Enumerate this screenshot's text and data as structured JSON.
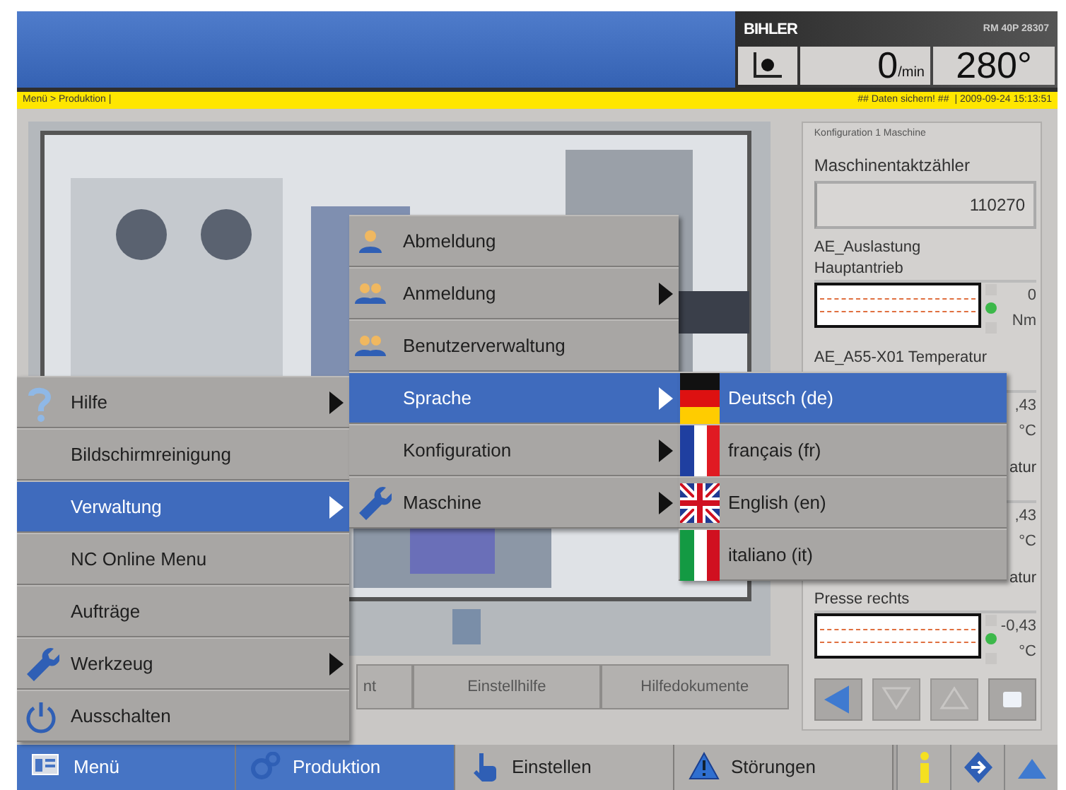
{
  "header": {
    "logo": "BIHLER",
    "machine": "RM 40P 28307",
    "speed": "0",
    "speed_unit": "/min",
    "angle": "280°"
  },
  "status_bar": {
    "breadcrumb": "Menü > Produktion |",
    "notice": "## Daten sichern! ##",
    "timestamp": "| 2009-09-24 15:13:51"
  },
  "work": {
    "buttons": [
      {
        "label": "nt",
        "kind": "cut"
      },
      {
        "label": "Einstellhilfe",
        "kind": "whole"
      },
      {
        "label": "Hilfedokumente",
        "kind": "whole"
      }
    ]
  },
  "side_panel": {
    "title": "Konfiguration 1 Maschine",
    "counter_label": "Maschinentaktzähler",
    "counter_value": "110270",
    "sensors": [
      {
        "lines": [
          {
            "text": "AE_Auslastung",
            "kind": "whole"
          },
          {
            "text": "Hauptantrieb",
            "kind": "whole"
          }
        ],
        "kind": "gauge",
        "value": "0",
        "unit": "Nm"
      },
      {
        "lines": [
          {
            "text": "AE_A55-X01 Temperatur",
            "kind": "whole"
          }
        ],
        "kind": "covered",
        "value": ",43",
        "unit": "°C"
      },
      {
        "lines": [
          {
            "text": "atur",
            "kind": "cut"
          }
        ],
        "kind": "covered",
        "value": ",43",
        "unit": "°C"
      },
      {
        "lines": [
          {
            "text": "atur",
            "kind": "cut"
          },
          {
            "text": "Presse rechts",
            "kind": "whole"
          }
        ],
        "kind": "gauge",
        "value": "-0,43",
        "unit": "°C"
      }
    ],
    "nav_buttons": [
      {
        "disabled": false
      },
      {
        "disabled": true
      },
      {
        "disabled": true
      },
      {
        "disabled": false
      }
    ]
  },
  "menus": [
    {
      "items": [
        {
          "label": "Hilfe",
          "submenu": true,
          "selected": false
        },
        {
          "label": "Bildschirmreinigung",
          "submenu": false,
          "selected": false
        },
        {
          "label": "Verwaltung",
          "submenu": true,
          "selected": true
        },
        {
          "label": "NC Online Menu",
          "submenu": false,
          "selected": false
        },
        {
          "label": "Aufträge",
          "submenu": false,
          "selected": false
        },
        {
          "label": "Werkzeug",
          "submenu": true,
          "selected": false
        },
        {
          "label": "Ausschalten",
          "submenu": false,
          "selected": false
        }
      ]
    },
    {
      "items": [
        {
          "label": "Abmeldung",
          "submenu": false,
          "selected": false
        },
        {
          "label": "Anmeldung",
          "submenu": true,
          "selected": false
        },
        {
          "label": "Benutzerverwaltung",
          "submenu": false,
          "selected": false
        },
        {
          "label": "Sprache",
          "submenu": true,
          "selected": true
        },
        {
          "label": "Konfiguration",
          "submenu": true,
          "selected": false
        },
        {
          "label": "Maschine",
          "submenu": true,
          "selected": false
        }
      ]
    },
    {
      "items": [
        {
          "label": "Deutsch (de)",
          "submenu": false,
          "selected": true
        },
        {
          "label": "français (fr)",
          "submenu": false,
          "selected": false
        },
        {
          "label": "English (en)",
          "submenu": false,
          "selected": false
        },
        {
          "label": "italiano (it)",
          "submenu": false,
          "selected": false
        }
      ]
    }
  ],
  "taskbar": {
    "items": [
      {
        "label": "Menü",
        "selected": true
      },
      {
        "label": "Produktion",
        "selected": true
      },
      {
        "label": "Einstellen",
        "selected": false
      },
      {
        "label": "Störungen",
        "selected": false
      }
    ]
  }
}
